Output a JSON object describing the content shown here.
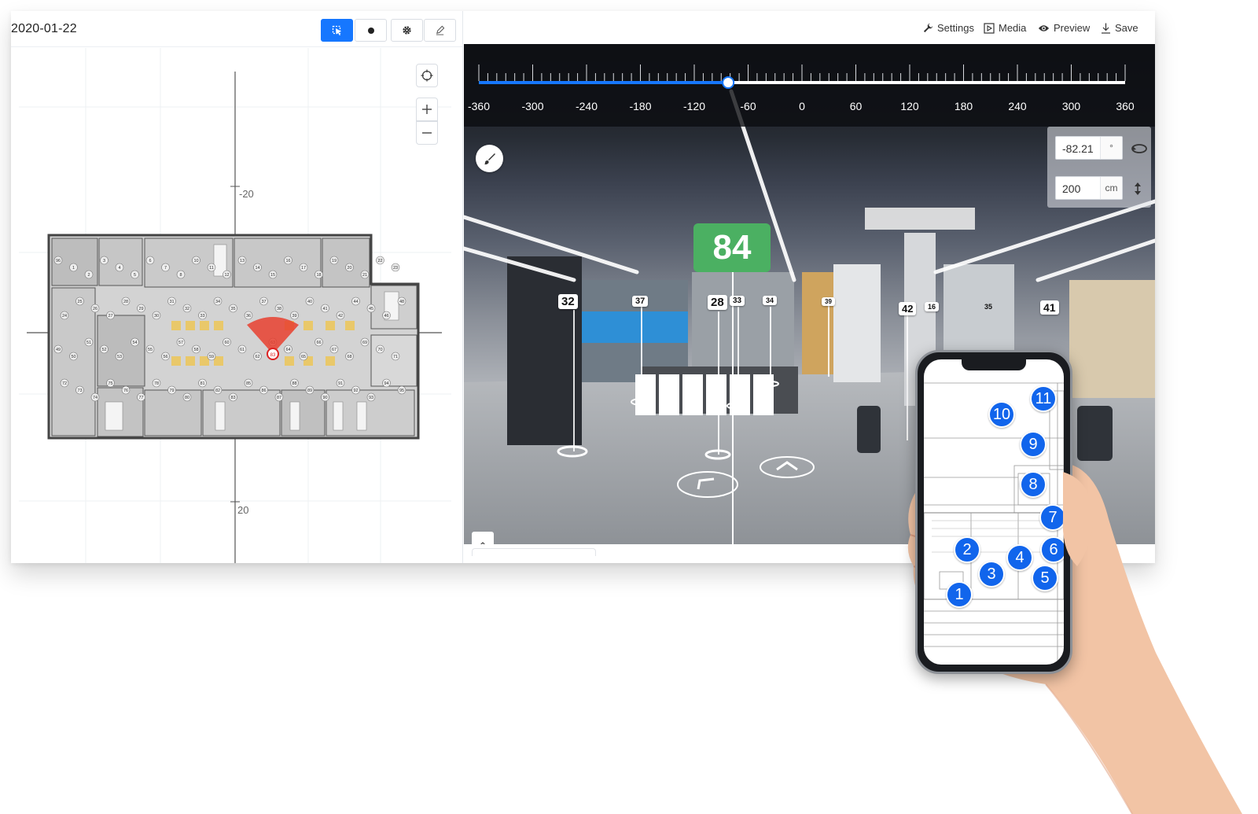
{
  "left_panel": {
    "date": "2020-01-22",
    "tools": [
      {
        "name": "select",
        "icon": "pointer-icon",
        "active": true
      },
      {
        "name": "point",
        "icon": "dot-icon",
        "active": false
      },
      {
        "name": "settings",
        "icon": "gear-icon",
        "active": false
      },
      {
        "name": "draw",
        "icon": "pencil-icon",
        "active": false
      }
    ],
    "map": {
      "axis_labels": [
        "-20",
        "20"
      ],
      "controls": [
        "crosshair-icon",
        "plus-icon",
        "minus-icon"
      ],
      "room_numbers": [
        "96",
        "1",
        "2",
        "3",
        "4",
        "5",
        "6",
        "7",
        "8",
        "10",
        "11",
        "12",
        "13",
        "14",
        "15",
        "16",
        "17",
        "18",
        "19",
        "20",
        "21",
        "22",
        "23",
        "24",
        "25",
        "26",
        "27",
        "28",
        "29",
        "30",
        "31",
        "32",
        "33",
        "34",
        "35",
        "36",
        "37",
        "38",
        "39",
        "40",
        "41",
        "42",
        "44",
        "45",
        "46",
        "48",
        "49",
        "50",
        "51",
        "52",
        "53",
        "54",
        "55",
        "56",
        "57",
        "58",
        "59",
        "60",
        "61",
        "62",
        "63",
        "64",
        "65",
        "66",
        "67",
        "68",
        "69",
        "70",
        "71",
        "72",
        "73",
        "74",
        "75",
        "76",
        "77",
        "78",
        "79",
        "80",
        "81",
        "82",
        "83",
        "85",
        "86",
        "87",
        "88",
        "89",
        "90",
        "91",
        "92",
        "93",
        "94",
        "95"
      ],
      "current_point": "83"
    }
  },
  "toolbar": {
    "settings_label": "Settings",
    "media_label": "Media",
    "preview_label": "Preview",
    "save_label": "Save"
  },
  "viewer": {
    "degree_labels": [
      "-360",
      "-300",
      "-240",
      "-180",
      "-120",
      "-60",
      "0",
      "60",
      "120",
      "180",
      "240",
      "300",
      "360"
    ],
    "slider_value": -82.21,
    "slider_range": [
      -360,
      360
    ],
    "heading": {
      "value": "-82.21",
      "unit": "°"
    },
    "height": {
      "value": "200",
      "unit": "cm"
    },
    "current_marker": "84",
    "markers": [
      "32",
      "37",
      "28",
      "33",
      "34",
      "39",
      "42",
      "16",
      "35",
      "41"
    ]
  },
  "phone": {
    "steps": [
      "1",
      "2",
      "3",
      "4",
      "5",
      "6",
      "7",
      "8",
      "9",
      "10",
      "11"
    ]
  },
  "colors": {
    "accent": "#1677ff",
    "marker_green": "#4bb062",
    "step_blue": "#1165ec",
    "fov_red": "#e8402f"
  }
}
